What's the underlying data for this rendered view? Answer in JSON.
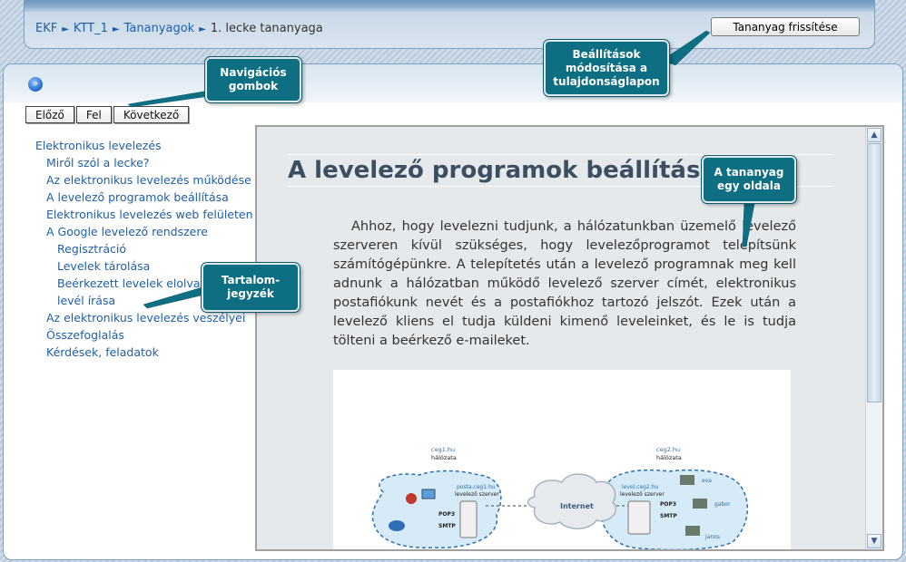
{
  "breadcrumb": {
    "items": [
      "EKF",
      "KTT_1",
      "Tananyagok"
    ],
    "current": "1. lecke tananyaga",
    "separator": "►"
  },
  "header": {
    "refresh_label": "Tananyag frissítése"
  },
  "nav": {
    "prev": "Előző",
    "up": "Fel",
    "next": "Következő"
  },
  "toc": [
    {
      "label": "Elektronikus levelezés",
      "level": 1
    },
    {
      "label": "Miről szól a lecke?",
      "level": 2
    },
    {
      "label": "Az elektronikus levelezés működése",
      "level": 2
    },
    {
      "label": "A levelező programok beállítása",
      "level": 2
    },
    {
      "label": "Elektronikus levelezés web felületen",
      "level": 2
    },
    {
      "label": "A Google levelező rendszere",
      "level": 2
    },
    {
      "label": "Regisztráció",
      "level": 3
    },
    {
      "label": "Levelek tárolása",
      "level": 3
    },
    {
      "label": "Beérkezett levelek elolvasása, új levél írása",
      "level": 3
    },
    {
      "label": "Az elektronikus levelezés veszélyei",
      "level": 2
    },
    {
      "label": "Összefoglalás",
      "level": 2
    },
    {
      "label": "Kérdések, feladatok",
      "level": 2
    }
  ],
  "content": {
    "title": "A levelező programok beállítása",
    "paragraph": "Ahhoz, hogy levelezni tudjunk, a hálózatunkban üzemelő levelező szerveren kívül szükséges, hogy levelezőprogramot telepítsünk számítógépünkre. A telepítetés után a levelező programnak meg kell adnunk a hálózatban működő levelező szerver címét, elektronikus postafiókunk nevét és a postafiókhoz tartozó jelszót. Ezek után a levelező kliens el tudja küldeni kimenő leveleinket, és le is tudja tölteni a beérkező e-maileket."
  },
  "figure": {
    "left_domain": "ceg1.hu",
    "left_net": "hálózata",
    "left_server_name": "posta.ceg1.hu",
    "left_server_label": "levelező szerver",
    "right_domain": "ceg2.hu",
    "right_net": "hálózata",
    "right_server_name": "level.ceg2.hu",
    "right_server_label": "levelező szerver",
    "cloud": "Internet",
    "pop3": "POP3",
    "smtp": "SMTP",
    "users": [
      "eva",
      "gabor",
      "janos"
    ]
  },
  "callouts": {
    "nav": "Navigációs gombok",
    "settings": "Beállítások módosítása a tulajdonságlapon",
    "page": "A tananyag egy oldala",
    "toc": "Tartalom-jegyzék"
  },
  "colors": {
    "callout_bg": "#0e6e82",
    "link": "#1f5fa6"
  }
}
